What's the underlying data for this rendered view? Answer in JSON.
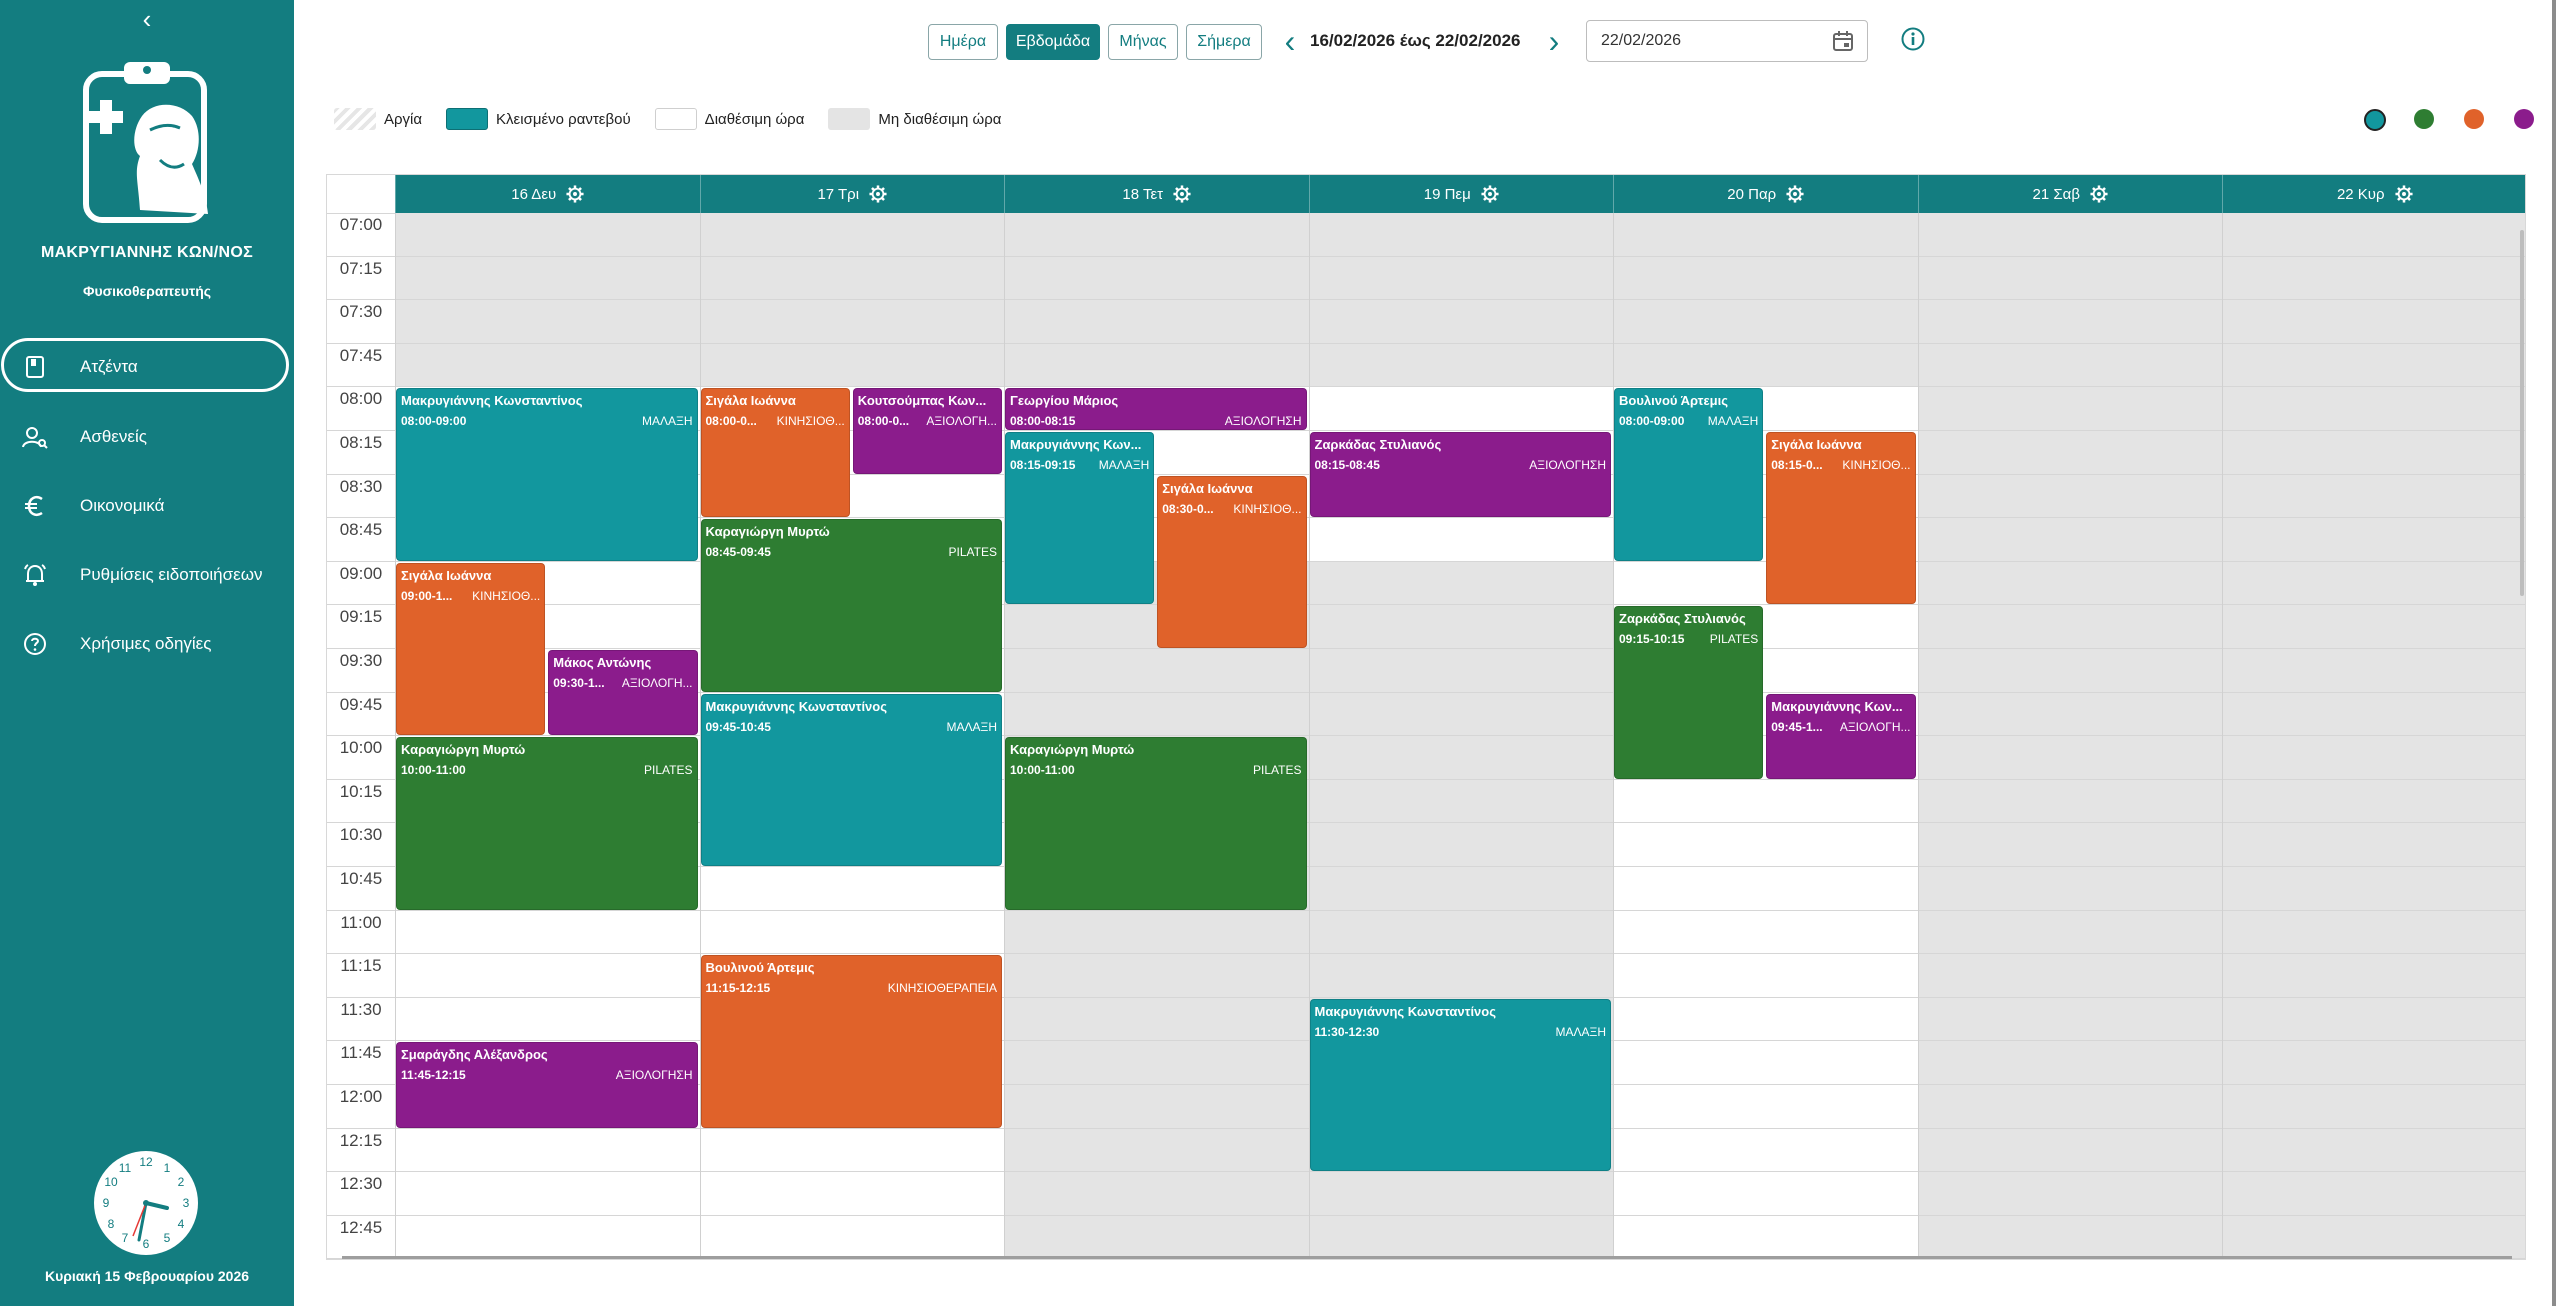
{
  "sidebar": {
    "collapse_glyph": "‹",
    "user_name": "ΜΑΚΡΥΓΙΑΝΝΗΣ ΚΩΝ/ΝΟΣ",
    "user_role": "Φυσικοθεραπευτής",
    "nav": [
      {
        "label": "Ατζέντα",
        "icon": "agenda-book-icon",
        "active": true
      },
      {
        "label": "Ασθενείς",
        "icon": "patients-icon",
        "active": false
      },
      {
        "label": "Οικονομικά",
        "icon": "euro-icon",
        "active": false
      },
      {
        "label": "Ρυθμίσεις ειδοποιήσεων",
        "icon": "notification-settings-icon",
        "active": false
      },
      {
        "label": "Χρήσιμες οδηγίες",
        "icon": "help-icon",
        "active": false
      }
    ],
    "footer_date": "Κυριακή 15 Φεβρουαρίου 2026"
  },
  "toolbar": {
    "views": [
      {
        "label": "Ημέρα",
        "active": false
      },
      {
        "label": "Εβδομάδα",
        "active": true
      },
      {
        "label": "Μήνας",
        "active": false
      },
      {
        "label": "Σήμερα",
        "active": false
      }
    ],
    "prev_glyph": "‹",
    "next_glyph": "›",
    "range": "16/02/2026 έως 22/02/2026",
    "date_value": "22/02/2026"
  },
  "legend": [
    {
      "label": "Αργία",
      "kind": "holiday"
    },
    {
      "label": "Κλεισμένο ραντεβού",
      "kind": "booked"
    },
    {
      "label": "Διαθέσιμη ώρα",
      "kind": "available"
    },
    {
      "label": "Μη διαθέσιμη ώρα",
      "kind": "unavailable"
    }
  ],
  "color_filters": [
    "#12979e",
    "#2e7d32",
    "#e0622a",
    "#8b1c8c"
  ],
  "colors": {
    "teal": "#12979e",
    "green": "#2e7d32",
    "orange": "#e0622a",
    "purple": "#8b1c8c",
    "brand": "#137d80"
  },
  "times": [
    "07:00",
    "07:15",
    "07:30",
    "07:45",
    "08:00",
    "08:15",
    "08:30",
    "08:45",
    "09:00",
    "09:15",
    "09:30",
    "09:45",
    "10:00",
    "10:15",
    "10:30",
    "10:45",
    "11:00",
    "11:15",
    "11:30",
    "11:45",
    "12:00",
    "12:15",
    "12:30",
    "12:45"
  ],
  "days": [
    {
      "label": "16 Δευ",
      "available": [
        4,
        24
      ]
    },
    {
      "label": "17 Τρι",
      "available": [
        4,
        24
      ]
    },
    {
      "label": "18 Τετ",
      "available": [
        4,
        8
      ]
    },
    {
      "label": "19 Πεμ",
      "available": [
        4,
        8
      ]
    },
    {
      "label": "20 Παρ",
      "available": [
        4,
        24
      ]
    },
    {
      "label": "21 Σαβ",
      "available": [
        0,
        0
      ]
    },
    {
      "label": "22 Κυρ",
      "available": [
        0,
        0
      ]
    }
  ],
  "appointments": [
    {
      "day": 0,
      "start": "08:00",
      "end": "09:00",
      "lane": 0,
      "lanes": 1,
      "name": "Μακρυγιάννης Κωνσταντίνος",
      "time": "08:00-09:00",
      "type": "ΜΑΛΑΞΗ",
      "color": "teal"
    },
    {
      "day": 0,
      "start": "09:00",
      "end": "10:00",
      "lane": 0,
      "lanes": 2,
      "name": "Σιγάλα Ιωάννα",
      "time": "09:00-1...",
      "type": "ΚΙΝΗΣΙΟΘ...",
      "color": "orange"
    },
    {
      "day": 0,
      "start": "09:30",
      "end": "10:00",
      "lane": 1,
      "lanes": 2,
      "name": "Μάκος Αντώνης",
      "time": "09:30-1...",
      "type": "ΑΞΙΟΛΟΓΗ...",
      "color": "purple"
    },
    {
      "day": 0,
      "start": "10:00",
      "end": "11:00",
      "lane": 0,
      "lanes": 1,
      "name": "Καραγιώργη Μυρτώ",
      "time": "10:00-11:00",
      "type": "PILATES",
      "color": "green"
    },
    {
      "day": 0,
      "start": "11:45",
      "end": "12:15",
      "lane": 0,
      "lanes": 1,
      "name": "Σμαράγδης Αλέξανδρος",
      "time": "11:45-12:15",
      "type": "ΑΞΙΟΛΟΓΗΣΗ",
      "color": "purple"
    },
    {
      "day": 1,
      "start": "08:00",
      "end": "08:45",
      "lane": 0,
      "lanes": 2,
      "name": "Σιγάλα Ιωάννα",
      "time": "08:00-0...",
      "type": "ΚΙΝΗΣΙΟΘ...",
      "color": "orange"
    },
    {
      "day": 1,
      "start": "08:00",
      "end": "08:30",
      "lane": 1,
      "lanes": 2,
      "name": "Κουτσούμπας Κων...",
      "time": "08:00-0...",
      "type": "ΑΞΙΟΛΟΓΗ...",
      "color": "purple"
    },
    {
      "day": 1,
      "start": "08:45",
      "end": "09:45",
      "lane": 0,
      "lanes": 1,
      "name": "Καραγιώργη Μυρτώ",
      "time": "08:45-09:45",
      "type": "PILATES",
      "color": "green"
    },
    {
      "day": 1,
      "start": "09:45",
      "end": "10:45",
      "lane": 0,
      "lanes": 1,
      "name": "Μακρυγιάννης Κωνσταντίνος",
      "time": "09:45-10:45",
      "type": "ΜΑΛΑΞΗ",
      "color": "teal"
    },
    {
      "day": 1,
      "start": "11:15",
      "end": "12:15",
      "lane": 0,
      "lanes": 1,
      "name": "Βουλινού Άρτεμις",
      "time": "11:15-12:15",
      "type": "ΚΙΝΗΣΙΟΘΕΡΑΠΕΙΑ",
      "color": "orange"
    },
    {
      "day": 2,
      "start": "08:00",
      "end": "08:15",
      "lane": 0,
      "lanes": 1,
      "name": "Γεωργίου Μάριος",
      "time": "08:00-08:15",
      "type": "ΑΞΙΟΛΟΓΗΣΗ",
      "color": "purple"
    },
    {
      "day": 2,
      "start": "08:15",
      "end": "09:15",
      "lane": 0,
      "lanes": 2,
      "name": "Μακρυγιάννης Κων...",
      "time": "08:15-09:15",
      "type": "ΜΑΛΑΞΗ",
      "color": "teal"
    },
    {
      "day": 2,
      "start": "08:30",
      "end": "09:30",
      "lane": 1,
      "lanes": 2,
      "name": "Σιγάλα Ιωάννα",
      "time": "08:30-0...",
      "type": "ΚΙΝΗΣΙΟΘ...",
      "color": "orange"
    },
    {
      "day": 2,
      "start": "10:00",
      "end": "11:00",
      "lane": 0,
      "lanes": 1,
      "name": "Καραγιώργη Μυρτώ",
      "time": "10:00-11:00",
      "type": "PILATES",
      "color": "green"
    },
    {
      "day": 3,
      "start": "08:15",
      "end": "08:45",
      "lane": 0,
      "lanes": 1,
      "name": "Ζαρκάδας Στυλιανός",
      "time": "08:15-08:45",
      "type": "ΑΞΙΟΛΟΓΗΣΗ",
      "color": "purple"
    },
    {
      "day": 3,
      "start": "11:30",
      "end": "12:30",
      "lane": 0,
      "lanes": 1,
      "name": "Μακρυγιάννης Κωνσταντίνος",
      "time": "11:30-12:30",
      "type": "ΜΑΛΑΞΗ",
      "color": "teal"
    },
    {
      "day": 4,
      "start": "08:00",
      "end": "09:00",
      "lane": 0,
      "lanes": 2,
      "name": "Βουλινού Άρτεμις",
      "time": "08:00-09:00",
      "type": "ΜΑΛΑΞΗ",
      "color": "teal"
    },
    {
      "day": 4,
      "start": "08:15",
      "end": "09:15",
      "lane": 1,
      "lanes": 2,
      "name": "Σιγάλα Ιωάννα",
      "time": "08:15-0...",
      "type": "ΚΙΝΗΣΙΟΘ...",
      "color": "orange"
    },
    {
      "day": 4,
      "start": "09:15",
      "end": "10:15",
      "lane": 0,
      "lanes": 2,
      "name": "Ζαρκάδας Στυλιανός",
      "time": "09:15-10:15",
      "type": "PILATES",
      "color": "green"
    },
    {
      "day": 4,
      "start": "09:45",
      "end": "10:15",
      "lane": 1,
      "lanes": 2,
      "name": "Μακρυγιάννης Κων...",
      "time": "09:45-1...",
      "type": "ΑΞΙΟΛΟΓΗ...",
      "color": "purple"
    }
  ]
}
